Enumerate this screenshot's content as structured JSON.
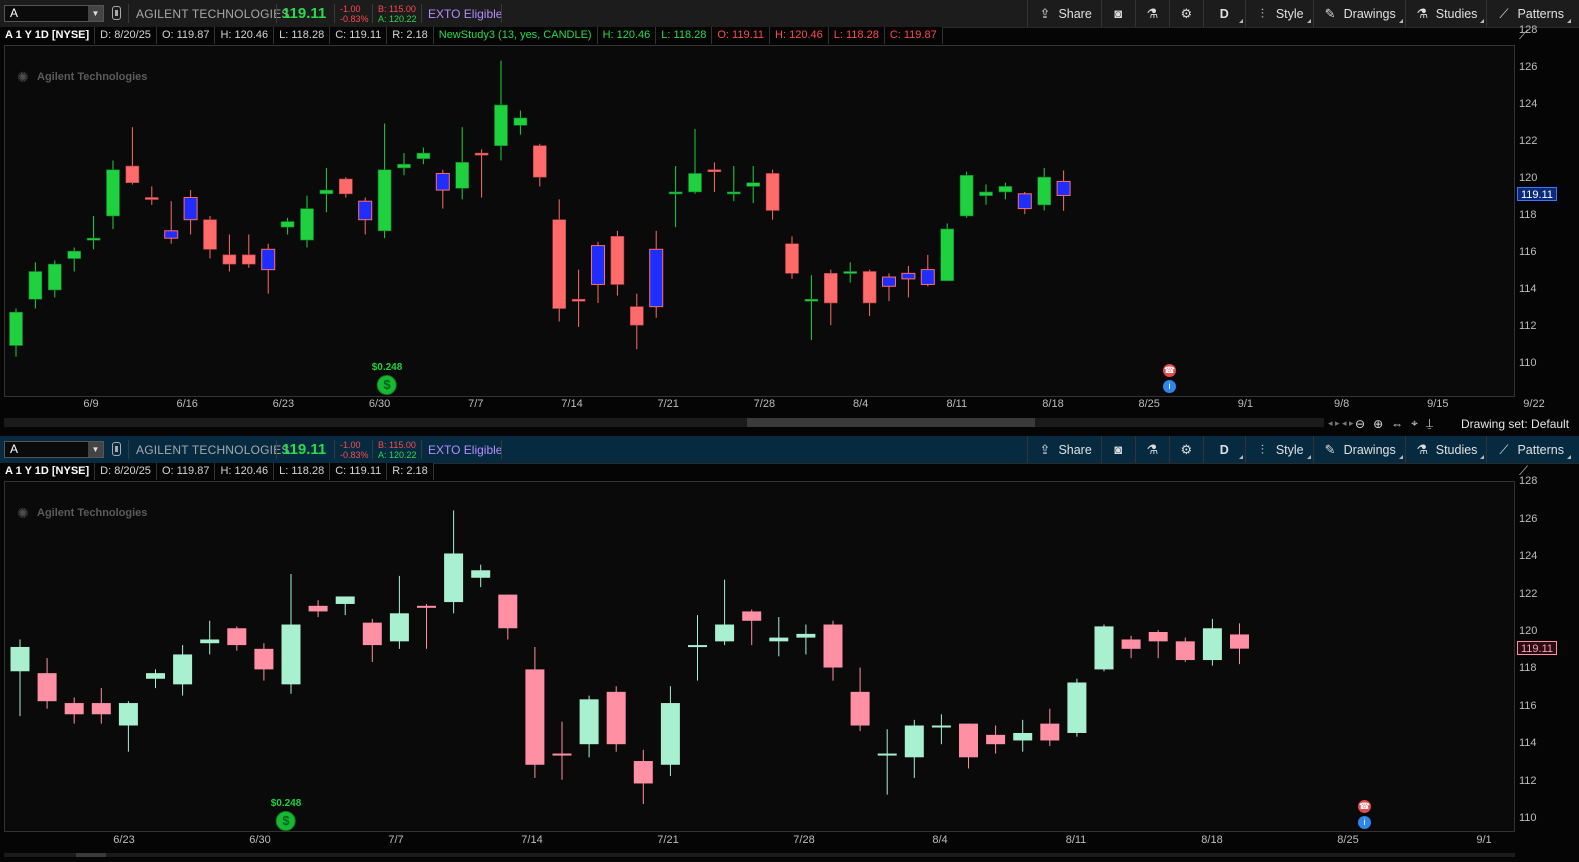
{
  "symbol": "A",
  "company_name": "AGILENT TECHNOLOGIES",
  "last_price": "119.11",
  "change": "-1.00",
  "change_pct": "-0.83%",
  "bid": "B: 115.00",
  "ask": "A: 120.22",
  "exto": "EXTO Eligible",
  "toolbar": {
    "share": "Share",
    "period": "D",
    "style": "Style",
    "drawings": "Drawings",
    "studies": "Studies",
    "patterns": "Patterns"
  },
  "info": {
    "title": "A 1 Y 1D [NYSE]",
    "date": "D: 8/20/25",
    "open": "O: 119.87",
    "high": "H: 120.46",
    "low": "L: 118.28",
    "close": "C: 119.11",
    "range": "R: 2.18"
  },
  "study": {
    "name": "NewStudy3 (13, yes, CANDLE)",
    "high": "H: 120.46",
    "low": "L: 118.28",
    "open": "O: 119.11",
    "high2": "H: 120.46",
    "low2": "L: 118.28",
    "close": "C: 119.87"
  },
  "watermark": "Agilent Technologies",
  "dividend": "$0.248",
  "drawing_set": "Drawing set: Default",
  "colors": {
    "up_green": "#1fd13f",
    "down_red": "#ff6b6b",
    "blue": "#1f2eff",
    "up_mint": "#a8f0d0",
    "down_pink": "#ff8fa3"
  },
  "chart_data": [
    {
      "type": "candlestick",
      "y_ticks": [
        110,
        112,
        114,
        116,
        118,
        120,
        122,
        124,
        126,
        128
      ],
      "x_ticks": [
        "6/9",
        "6/16",
        "6/23",
        "6/30",
        "7/7",
        "7/14",
        "7/21",
        "7/28",
        "8/4",
        "8/11",
        "8/18",
        "8/25",
        "9/1",
        "9/8",
        "9/15",
        "9/22"
      ],
      "last": 119.11,
      "candles": [
        {
          "o": 111.0,
          "h": 113.0,
          "l": 110.4,
          "c": 112.8,
          "k": "g"
        },
        {
          "o": 113.5,
          "h": 115.5,
          "l": 113.0,
          "c": 115.0,
          "k": "g"
        },
        {
          "o": 114.0,
          "h": 115.6,
          "l": 113.6,
          "c": 115.4,
          "k": "g"
        },
        {
          "o": 115.7,
          "h": 116.3,
          "l": 115.0,
          "c": 116.1,
          "k": "g"
        },
        {
          "o": 116.7,
          "h": 118.0,
          "l": 116.2,
          "c": 116.8,
          "k": "g"
        },
        {
          "o": 118.0,
          "h": 121.0,
          "l": 117.3,
          "c": 120.5,
          "k": "g"
        },
        {
          "o": 120.7,
          "h": 122.8,
          "l": 119.7,
          "c": 119.8,
          "k": "r"
        },
        {
          "o": 118.9,
          "h": 119.6,
          "l": 118.6,
          "c": 119.0,
          "k": "r"
        },
        {
          "o": 116.8,
          "h": 118.8,
          "l": 116.5,
          "c": 117.2,
          "k": "b"
        },
        {
          "o": 119.0,
          "h": 119.4,
          "l": 117.0,
          "c": 117.8,
          "k": "b"
        },
        {
          "o": 117.8,
          "h": 118.0,
          "l": 115.7,
          "c": 116.2,
          "k": "r"
        },
        {
          "o": 115.9,
          "h": 117.0,
          "l": 115.0,
          "c": 115.4,
          "k": "r"
        },
        {
          "o": 115.9,
          "h": 117.0,
          "l": 115.2,
          "c": 115.4,
          "k": "r"
        },
        {
          "o": 116.2,
          "h": 116.5,
          "l": 113.8,
          "c": 115.1,
          "k": "b"
        },
        {
          "o": 117.4,
          "h": 117.9,
          "l": 117.0,
          "c": 117.7,
          "k": "g"
        },
        {
          "o": 116.7,
          "h": 119.1,
          "l": 116.3,
          "c": 118.4,
          "k": "g"
        },
        {
          "o": 119.2,
          "h": 120.6,
          "l": 118.2,
          "c": 119.4,
          "k": "g"
        },
        {
          "o": 120.0,
          "h": 120.1,
          "l": 119.0,
          "c": 119.2,
          "k": "r"
        },
        {
          "o": 117.8,
          "h": 119.0,
          "l": 117.0,
          "c": 118.8,
          "k": "b"
        },
        {
          "o": 117.2,
          "h": 123.0,
          "l": 116.8,
          "c": 120.5,
          "k": "g"
        },
        {
          "o": 120.6,
          "h": 121.4,
          "l": 120.2,
          "c": 120.8,
          "k": "g"
        },
        {
          "o": 121.1,
          "h": 121.7,
          "l": 120.8,
          "c": 121.4,
          "k": "g"
        },
        {
          "o": 120.3,
          "h": 120.5,
          "l": 118.4,
          "c": 119.4,
          "k": "b"
        },
        {
          "o": 119.5,
          "h": 122.8,
          "l": 118.9,
          "c": 120.9,
          "k": "g"
        },
        {
          "o": 121.4,
          "h": 121.6,
          "l": 119.0,
          "c": 121.4,
          "k": "r"
        },
        {
          "o": 121.8,
          "h": 126.4,
          "l": 121.0,
          "c": 124.0,
          "k": "g"
        },
        {
          "o": 122.9,
          "h": 123.7,
          "l": 122.4,
          "c": 123.3,
          "k": "g"
        },
        {
          "o": 121.8,
          "h": 121.9,
          "l": 119.6,
          "c": 120.1,
          "k": "r"
        },
        {
          "o": 117.8,
          "h": 118.9,
          "l": 112.3,
          "c": 113.0,
          "k": "r"
        },
        {
          "o": 113.5,
          "h": 115.1,
          "l": 112.0,
          "c": 113.5,
          "k": "r"
        },
        {
          "o": 114.3,
          "h": 116.6,
          "l": 113.3,
          "c": 116.4,
          "k": "b"
        },
        {
          "o": 116.9,
          "h": 117.2,
          "l": 113.7,
          "c": 114.3,
          "k": "r"
        },
        {
          "o": 113.1,
          "h": 113.8,
          "l": 110.8,
          "c": 112.1,
          "k": "r"
        },
        {
          "o": 116.2,
          "h": 117.2,
          "l": 112.5,
          "c": 113.1,
          "k": "b"
        },
        {
          "o": 119.2,
          "h": 120.7,
          "l": 117.4,
          "c": 119.3,
          "k": "g"
        },
        {
          "o": 119.3,
          "h": 122.7,
          "l": 119.2,
          "c": 120.3,
          "k": "g"
        },
        {
          "o": 120.5,
          "h": 120.9,
          "l": 119.3,
          "c": 120.4,
          "k": "r"
        },
        {
          "o": 119.2,
          "h": 120.7,
          "l": 118.8,
          "c": 119.3,
          "k": "g"
        },
        {
          "o": 119.6,
          "h": 120.7,
          "l": 118.7,
          "c": 119.8,
          "k": "g"
        },
        {
          "o": 120.3,
          "h": 120.5,
          "l": 117.8,
          "c": 118.3,
          "k": "r"
        },
        {
          "o": 116.5,
          "h": 116.9,
          "l": 114.6,
          "c": 114.9,
          "k": "r"
        },
        {
          "o": 113.5,
          "h": 114.8,
          "l": 111.3,
          "c": 113.5,
          "k": "g"
        },
        {
          "o": 114.9,
          "h": 115.1,
          "l": 112.1,
          "c": 113.3,
          "k": "r"
        },
        {
          "o": 114.9,
          "h": 115.5,
          "l": 114.4,
          "c": 115.0,
          "k": "g"
        },
        {
          "o": 115.0,
          "h": 115.1,
          "l": 112.6,
          "c": 113.3,
          "k": "r"
        },
        {
          "o": 114.7,
          "h": 114.9,
          "l": 113.4,
          "c": 114.2,
          "k": "b"
        },
        {
          "o": 114.9,
          "h": 115.3,
          "l": 113.6,
          "c": 114.6,
          "k": "b"
        },
        {
          "o": 115.1,
          "h": 115.9,
          "l": 114.2,
          "c": 114.3,
          "k": "b"
        },
        {
          "o": 114.5,
          "h": 117.6,
          "l": 114.5,
          "c": 117.3,
          "k": "g"
        },
        {
          "o": 118.0,
          "h": 120.4,
          "l": 117.9,
          "c": 120.2,
          "k": "g"
        },
        {
          "o": 119.1,
          "h": 119.7,
          "l": 118.6,
          "c": 119.3,
          "k": "g"
        },
        {
          "o": 119.3,
          "h": 119.8,
          "l": 118.9,
          "c": 119.6,
          "k": "g"
        },
        {
          "o": 119.2,
          "h": 119.3,
          "l": 118.1,
          "c": 118.4,
          "k": "b"
        },
        {
          "o": 118.6,
          "h": 120.6,
          "l": 118.3,
          "c": 120.1,
          "k": "g"
        },
        {
          "o": 119.87,
          "h": 120.46,
          "l": 118.28,
          "c": 119.11,
          "k": "b"
        }
      ]
    },
    {
      "type": "candlestick",
      "y_ticks": [
        110,
        112,
        114,
        116,
        118,
        120,
        122,
        124,
        126,
        128
      ],
      "x_ticks": [
        "6/23",
        "6/30",
        "7/7",
        "7/14",
        "7/21",
        "7/28",
        "8/4",
        "8/11",
        "8/18",
        "8/25",
        "9/1"
      ],
      "last": 119.11,
      "candles": [
        {
          "o": 117.9,
          "h": 119.6,
          "l": 115.5,
          "c": 119.2,
          "k": "m"
        },
        {
          "o": 117.8,
          "h": 118.6,
          "l": 115.9,
          "c": 116.3,
          "k": "p"
        },
        {
          "o": 116.2,
          "h": 116.5,
          "l": 115.1,
          "c": 115.6,
          "k": "p"
        },
        {
          "o": 116.2,
          "h": 117.0,
          "l": 115.1,
          "c": 115.6,
          "k": "p"
        },
        {
          "o": 115.0,
          "h": 116.3,
          "l": 113.6,
          "c": 116.2,
          "k": "m"
        },
        {
          "o": 117.5,
          "h": 118.0,
          "l": 117.0,
          "c": 117.8,
          "k": "m"
        },
        {
          "o": 117.2,
          "h": 119.3,
          "l": 116.6,
          "c": 118.8,
          "k": "m"
        },
        {
          "o": 119.4,
          "h": 120.6,
          "l": 118.8,
          "c": 119.6,
          "k": "m"
        },
        {
          "o": 120.2,
          "h": 120.3,
          "l": 119.0,
          "c": 119.3,
          "k": "p"
        },
        {
          "o": 119.1,
          "h": 119.4,
          "l": 117.4,
          "c": 118.0,
          "k": "p"
        },
        {
          "o": 117.2,
          "h": 123.1,
          "l": 116.7,
          "c": 120.4,
          "k": "m"
        },
        {
          "o": 121.1,
          "h": 121.7,
          "l": 120.8,
          "c": 121.4,
          "k": "p"
        },
        {
          "o": 121.5,
          "h": 121.9,
          "l": 120.9,
          "c": 121.9,
          "k": "m"
        },
        {
          "o": 120.5,
          "h": 120.7,
          "l": 118.4,
          "c": 119.3,
          "k": "p"
        },
        {
          "o": 119.5,
          "h": 123.0,
          "l": 119.1,
          "c": 121.0,
          "k": "m"
        },
        {
          "o": 121.4,
          "h": 121.5,
          "l": 119.1,
          "c": 121.4,
          "k": "p"
        },
        {
          "o": 121.6,
          "h": 126.5,
          "l": 121.0,
          "c": 124.2,
          "k": "m"
        },
        {
          "o": 122.9,
          "h": 123.6,
          "l": 122.4,
          "c": 123.3,
          "k": "m"
        },
        {
          "o": 122.0,
          "h": 122.0,
          "l": 119.6,
          "c": 120.2,
          "k": "p"
        },
        {
          "o": 118.0,
          "h": 119.2,
          "l": 112.2,
          "c": 112.9,
          "k": "p"
        },
        {
          "o": 113.5,
          "h": 115.2,
          "l": 112.1,
          "c": 113.5,
          "k": "p"
        },
        {
          "o": 114.0,
          "h": 116.6,
          "l": 113.3,
          "c": 116.4,
          "k": "m"
        },
        {
          "o": 116.8,
          "h": 117.1,
          "l": 113.6,
          "c": 114.0,
          "k": "p"
        },
        {
          "o": 113.1,
          "h": 113.7,
          "l": 110.8,
          "c": 111.9,
          "k": "p"
        },
        {
          "o": 112.9,
          "h": 117.1,
          "l": 112.3,
          "c": 116.2,
          "k": "m"
        },
        {
          "o": 119.2,
          "h": 120.9,
          "l": 117.4,
          "c": 119.3,
          "k": "m"
        },
        {
          "o": 119.5,
          "h": 122.8,
          "l": 119.3,
          "c": 120.4,
          "k": "m"
        },
        {
          "o": 121.1,
          "h": 121.2,
          "l": 119.3,
          "c": 120.6,
          "k": "p"
        },
        {
          "o": 119.5,
          "h": 120.8,
          "l": 118.7,
          "c": 119.7,
          "k": "m"
        },
        {
          "o": 119.7,
          "h": 120.4,
          "l": 118.8,
          "c": 119.9,
          "k": "m"
        },
        {
          "o": 120.4,
          "h": 120.6,
          "l": 117.4,
          "c": 118.1,
          "k": "p"
        },
        {
          "o": 116.8,
          "h": 118.1,
          "l": 114.7,
          "c": 115.0,
          "k": "p"
        },
        {
          "o": 113.5,
          "h": 114.8,
          "l": 111.3,
          "c": 113.5,
          "k": "m"
        },
        {
          "o": 113.3,
          "h": 115.3,
          "l": 112.2,
          "c": 115.0,
          "k": "m"
        },
        {
          "o": 114.9,
          "h": 115.6,
          "l": 114.0,
          "c": 115.0,
          "k": "m"
        },
        {
          "o": 115.1,
          "h": 115.1,
          "l": 112.7,
          "c": 113.3,
          "k": "p"
        },
        {
          "o": 114.5,
          "h": 115.0,
          "l": 113.5,
          "c": 114.0,
          "k": "p"
        },
        {
          "o": 114.2,
          "h": 115.3,
          "l": 113.6,
          "c": 114.6,
          "k": "m"
        },
        {
          "o": 115.1,
          "h": 115.9,
          "l": 113.9,
          "c": 114.2,
          "k": "p"
        },
        {
          "o": 114.6,
          "h": 117.5,
          "l": 114.4,
          "c": 117.3,
          "k": "m"
        },
        {
          "o": 118.0,
          "h": 120.4,
          "l": 117.9,
          "c": 120.3,
          "k": "m"
        },
        {
          "o": 119.6,
          "h": 119.8,
          "l": 118.6,
          "c": 119.1,
          "k": "p"
        },
        {
          "o": 120.0,
          "h": 120.1,
          "l": 118.6,
          "c": 119.5,
          "k": "p"
        },
        {
          "o": 119.5,
          "h": 119.7,
          "l": 118.4,
          "c": 118.5,
          "k": "p"
        },
        {
          "o": 118.5,
          "h": 120.7,
          "l": 118.2,
          "c": 120.2,
          "k": "m"
        },
        {
          "o": 119.87,
          "h": 120.46,
          "l": 118.28,
          "c": 119.11,
          "k": "p"
        }
      ]
    }
  ]
}
